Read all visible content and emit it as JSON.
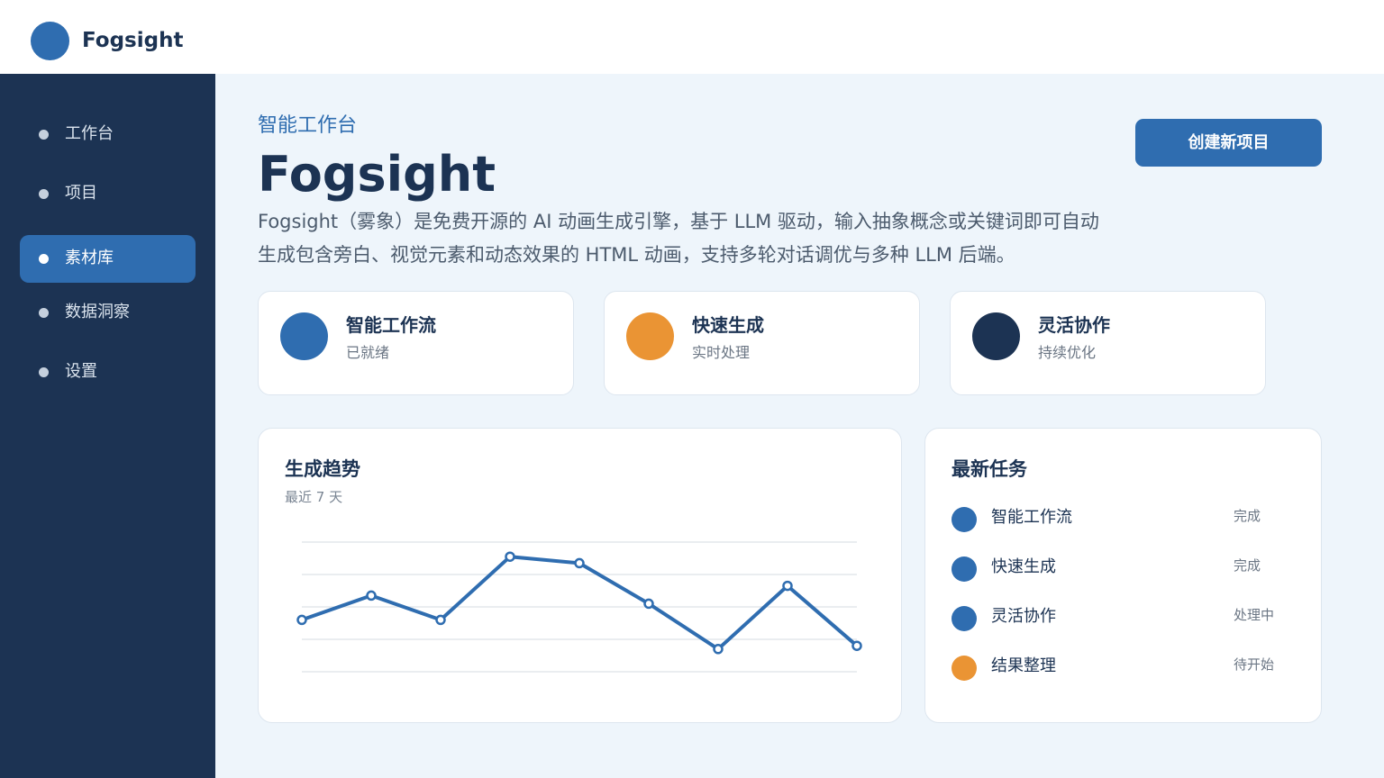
{
  "header": {
    "brand": "Fogsight"
  },
  "sidebar": {
    "items": [
      {
        "label": "工作台",
        "active": false
      },
      {
        "label": "项目",
        "active": false
      },
      {
        "label": "素材库",
        "active": true
      },
      {
        "label": "数据洞察",
        "active": false
      },
      {
        "label": "设置",
        "active": false
      }
    ]
  },
  "main": {
    "kicker": "智能工作台",
    "title": "Fogsight",
    "description_line1": "Fogsight（雾象）是免费开源的 AI 动画生成引擎，基于 LLM 驱动，输入抽象概念或关键词即可自动",
    "description_line2": "生成包含旁白、视觉元素和动态效果的 HTML 动画，支持多轮对话调优与多种 LLM 后端。",
    "create_button": "创建新项目"
  },
  "features": [
    {
      "title": "智能工作流",
      "subtitle": "已就绪",
      "color": "#2f6db0"
    },
    {
      "title": "快速生成",
      "subtitle": "实时处理",
      "color": "#ea9434"
    },
    {
      "title": "灵活协作",
      "subtitle": "持续优化",
      "color": "#1c3353"
    }
  ],
  "trend": {
    "title": "生成趋势",
    "subtitle": "最近 7 天"
  },
  "chart_data": {
    "type": "line",
    "x": [
      1,
      2,
      3,
      4,
      5,
      6,
      7,
      8,
      9
    ],
    "series": [
      {
        "values": [
          1.6,
          2.35,
          1.6,
          3.55,
          3.35,
          2.1,
          0.7,
          2.65,
          0.8
        ],
        "color": "#2f6db0"
      }
    ],
    "ylim": [
      0,
      4
    ],
    "grid": true,
    "xlabel": "",
    "ylabel": ""
  },
  "tasks": {
    "title": "最新任务",
    "items": [
      {
        "name": "智能工作流",
        "status": "完成",
        "color": "#2f6db0"
      },
      {
        "name": "快速生成",
        "status": "完成",
        "color": "#2f6db0"
      },
      {
        "name": "灵活协作",
        "status": "处理中",
        "color": "#2f6db0"
      },
      {
        "name": "结果整理",
        "status": "待开始",
        "color": "#ea9434"
      }
    ]
  }
}
